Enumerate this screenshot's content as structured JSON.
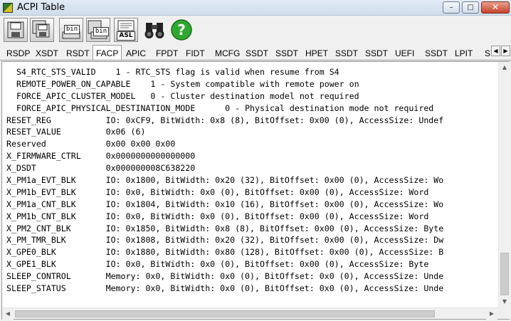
{
  "window": {
    "title": "ACPI Table",
    "minimize_glyph": "–",
    "maximize_glyph": "□",
    "close_glyph": "✕"
  },
  "toolbar": {
    "buttons": [
      {
        "name": "save-icon",
        "label": ""
      },
      {
        "name": "save-all-icon",
        "label": ""
      },
      {
        "name": "save-bin-icon",
        "label": "bin"
      },
      {
        "name": "save-all-bin-icon",
        "label": "bin"
      },
      {
        "name": "asl-icon",
        "label": "ASL"
      },
      {
        "name": "binoculars-icon",
        "label": ""
      },
      {
        "name": "help-icon",
        "label": "?"
      }
    ]
  },
  "tabs": [
    "RSDP",
    "XSDT",
    "RSDT",
    "FACP",
    "APIC",
    "FPDT",
    "FIDT",
    "MCFG",
    "SSDT",
    "SSDT",
    "HPET",
    "SSDT",
    "SSDT",
    "UEFI",
    "SSDT",
    "LPIT",
    "S"
  ],
  "active_tab": "FACP",
  "tab_scroll": {
    "left": "◀",
    "right": "▶"
  },
  "lines": [
    "  S4_RTC_STS_VALID    1 - RTC_STS flag is valid when resume from S4",
    "  REMOTE_POWER_ON_CAPABLE    1 - System compatible with remote power on",
    "  FORCE_APIC_CLUSTER_MODEL   0 - Cluster destination model not required",
    "  FORCE_APIC_PHYSICAL_DESTINATION_MODE      0 - Physical destination mode not required",
    "RESET_REG           IO: 0xCF9, BitWidth: 0x8 (8), BitOffset: 0x00 (0), AccessSize: Undef",
    "RESET_VALUE         0x06 (6)",
    "Reserved            0x00 0x00 0x00",
    "X_FIRMWARE_CTRL     0x0000000000000000",
    "X_DSDT              0x000000008C638220",
    "X_PM1a_EVT_BLK      IO: 0x1800, BitWidth: 0x20 (32), BitOffset: 0x00 (0), AccessSize: Wo",
    "X_PM1b_EVT_BLK      IO: 0x0, BitWidth: 0x0 (0), BitOffset: 0x00 (0), AccessSize: Word",
    "X_PM1a_CNT_BLK      IO: 0x1804, BitWidth: 0x10 (16), BitOffset: 0x00 (0), AccessSize: Wo",
    "X_PM1b_CNT_BLK      IO: 0x0, BitWidth: 0x0 (0), BitOffset: 0x00 (0), AccessSize: Word",
    "X_PM2_CNT_BLK       IO: 0x1850, BitWidth: 0x8 (8), BitOffset: 0x00 (0), AccessSize: Byte",
    "X_PM_TMR_BLK        IO: 0x1808, BitWidth: 0x20 (32), BitOffset: 0x00 (0), AccessSize: Dw",
    "X_GPE0_BLK          IO: 0x1880, BitWidth: 0x80 (128), BitOffset: 0x00 (0), AccessSize: B",
    "X_GPE1_BLK          IO: 0x0, BitWidth: 0x0 (0), BitOffset: 0x00 (0), AccessSize: Byte",
    "SLEEP_CONTROL       Memory: 0x0, BitWidth: 0x0 (0), BitOffset: 0x0 (0), AccessSize: Unde",
    "SLEEP_STATUS        Memory: 0x0, BitWidth: 0x0 (0), BitOffset: 0x0 (0), AccessSize: Unde"
  ],
  "scrollbars": {
    "up": "▲",
    "down": "▼",
    "left": "◀",
    "right": "▶"
  }
}
